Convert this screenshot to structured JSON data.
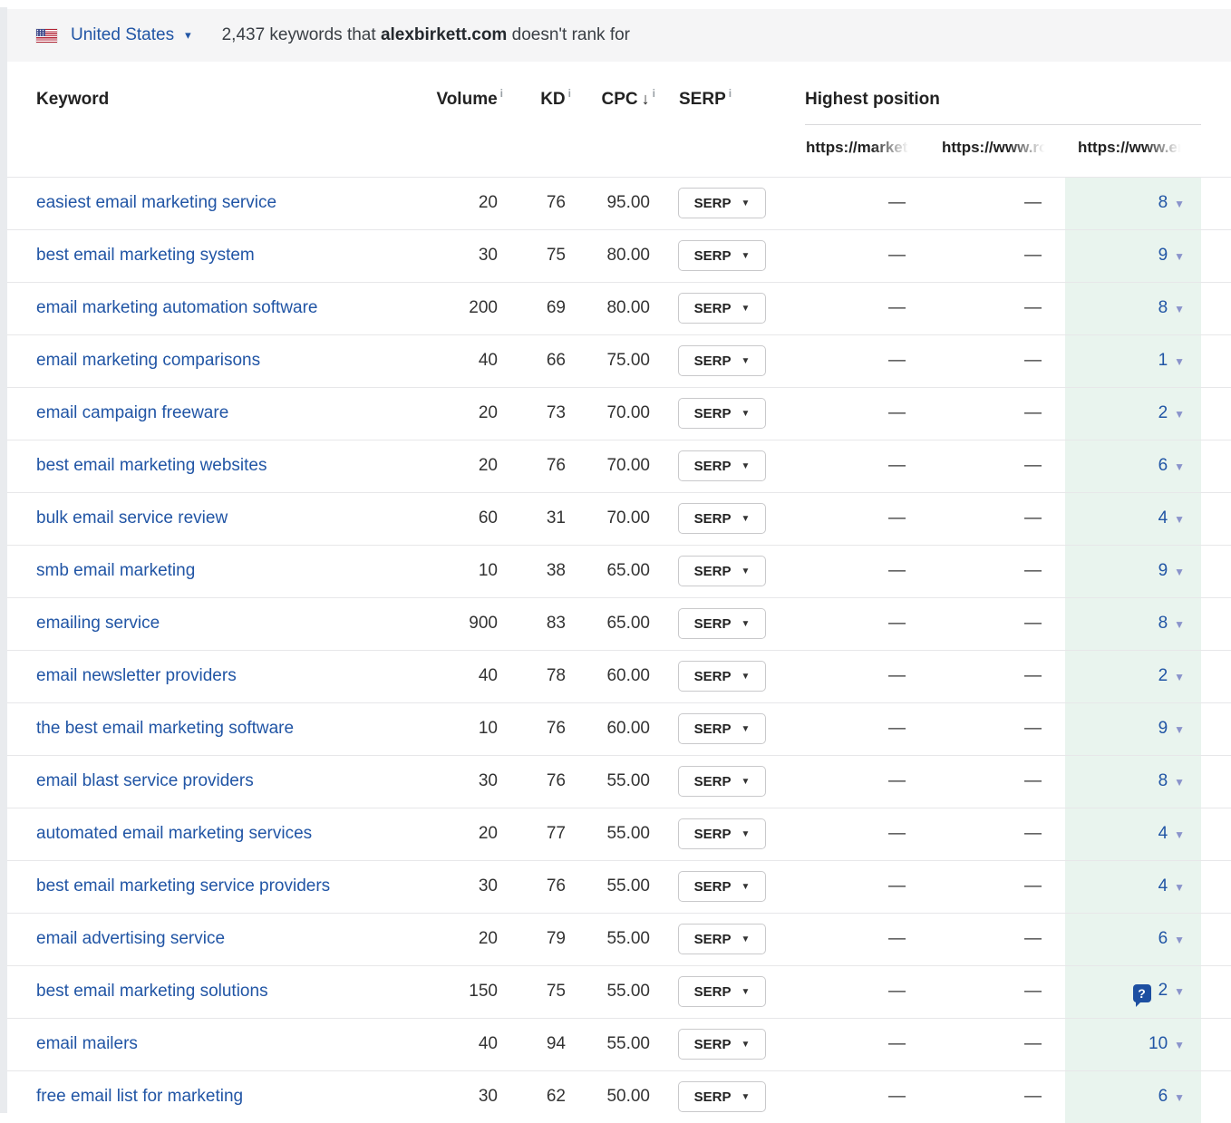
{
  "topbar": {
    "country": "United States",
    "summary_prefix": "2,437 keywords that ",
    "summary_domain": "alexbirkett.com",
    "summary_suffix": " doesn't rank for"
  },
  "icons": {
    "chevron_down": "▼",
    "caret_down": "▾",
    "sort_desc": "↓",
    "info": "i",
    "question_mark": "?",
    "flag": "us-flag"
  },
  "table": {
    "headers": {
      "keyword": "Keyword",
      "volume": "Volume",
      "kd": "KD",
      "cpc": "CPC",
      "serp": "SERP",
      "highest_position": "Highest position",
      "url_columns": [
        "https://marketi",
        "https://www.ro",
        "https://www.er"
      ]
    },
    "serp_button_label": "SERP",
    "rows": [
      {
        "keyword": "easiest email marketing service",
        "volume": "20",
        "kd": "76",
        "cpc": "95.00",
        "pos1": "—",
        "pos2": "—",
        "pos3": "8",
        "question": false
      },
      {
        "keyword": "best email marketing system",
        "volume": "30",
        "kd": "75",
        "cpc": "80.00",
        "pos1": "—",
        "pos2": "—",
        "pos3": "9",
        "question": false
      },
      {
        "keyword": "email marketing automation software",
        "volume": "200",
        "kd": "69",
        "cpc": "80.00",
        "pos1": "—",
        "pos2": "—",
        "pos3": "8",
        "question": false
      },
      {
        "keyword": "email marketing comparisons",
        "volume": "40",
        "kd": "66",
        "cpc": "75.00",
        "pos1": "—",
        "pos2": "—",
        "pos3": "1",
        "question": false
      },
      {
        "keyword": "email campaign freeware",
        "volume": "20",
        "kd": "73",
        "cpc": "70.00",
        "pos1": "—",
        "pos2": "—",
        "pos3": "2",
        "question": false
      },
      {
        "keyword": "best email marketing websites",
        "volume": "20",
        "kd": "76",
        "cpc": "70.00",
        "pos1": "—",
        "pos2": "—",
        "pos3": "6",
        "question": false
      },
      {
        "keyword": "bulk email service review",
        "volume": "60",
        "kd": "31",
        "cpc": "70.00",
        "pos1": "—",
        "pos2": "—",
        "pos3": "4",
        "question": false
      },
      {
        "keyword": "smb email marketing",
        "volume": "10",
        "kd": "38",
        "cpc": "65.00",
        "pos1": "—",
        "pos2": "—",
        "pos3": "9",
        "question": false
      },
      {
        "keyword": "emailing service",
        "volume": "900",
        "kd": "83",
        "cpc": "65.00",
        "pos1": "—",
        "pos2": "—",
        "pos3": "8",
        "question": false
      },
      {
        "keyword": "email newsletter providers",
        "volume": "40",
        "kd": "78",
        "cpc": "60.00",
        "pos1": "—",
        "pos2": "—",
        "pos3": "2",
        "question": false
      },
      {
        "keyword": "the best email marketing software",
        "volume": "10",
        "kd": "76",
        "cpc": "60.00",
        "pos1": "—",
        "pos2": "—",
        "pos3": "9",
        "question": false
      },
      {
        "keyword": "email blast service providers",
        "volume": "30",
        "kd": "76",
        "cpc": "55.00",
        "pos1": "—",
        "pos2": "—",
        "pos3": "8",
        "question": false
      },
      {
        "keyword": "automated email marketing services",
        "volume": "20",
        "kd": "77",
        "cpc": "55.00",
        "pos1": "—",
        "pos2": "—",
        "pos3": "4",
        "question": false
      },
      {
        "keyword": "best email marketing service providers",
        "volume": "30",
        "kd": "76",
        "cpc": "55.00",
        "pos1": "—",
        "pos2": "—",
        "pos3": "4",
        "question": false
      },
      {
        "keyword": "email advertising service",
        "volume": "20",
        "kd": "79",
        "cpc": "55.00",
        "pos1": "—",
        "pos2": "—",
        "pos3": "6",
        "question": false
      },
      {
        "keyword": "best email marketing solutions",
        "volume": "150",
        "kd": "75",
        "cpc": "55.00",
        "pos1": "—",
        "pos2": "—",
        "pos3": "2",
        "question": true
      },
      {
        "keyword": "email mailers",
        "volume": "40",
        "kd": "94",
        "cpc": "55.00",
        "pos1": "—",
        "pos2": "—",
        "pos3": "10",
        "question": false
      },
      {
        "keyword": "free email list for marketing",
        "volume": "30",
        "kd": "62",
        "cpc": "50.00",
        "pos1": "—",
        "pos2": "—",
        "pos3": "6",
        "question": false
      }
    ]
  },
  "colors": {
    "link_blue": "#2155a5",
    "position_green_bg": "#e9f4ee",
    "topbar_bg": "#f5f5f6",
    "question_icon_bg": "#1d4fa1",
    "caret_purple": "#8a93cb"
  }
}
